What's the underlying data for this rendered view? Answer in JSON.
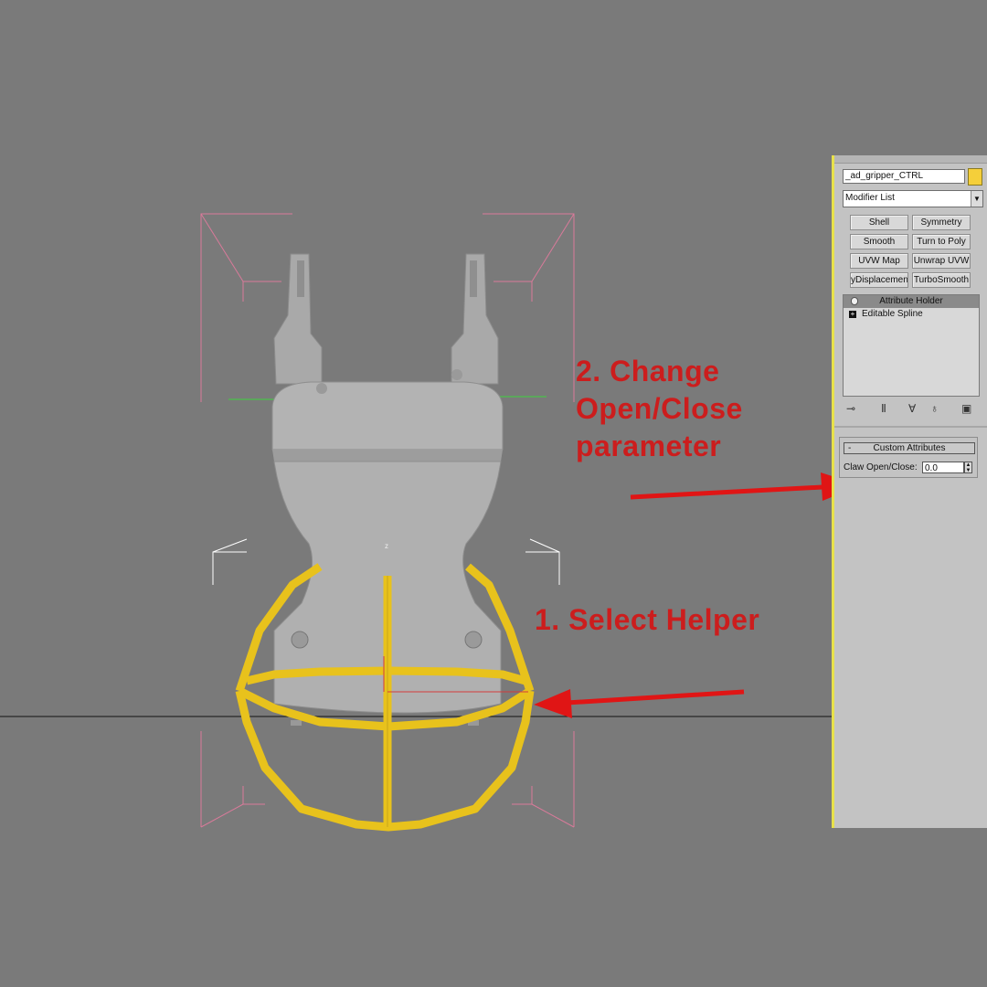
{
  "annotations": {
    "step1": "1. Select Helper",
    "step2": "2. Change Open/Close parameter"
  },
  "viewport": {
    "axis_label": "z",
    "selected_helper_color": "#f5cf3a",
    "bounding_box_color": "#d97a9a"
  },
  "command_panel": {
    "object_name": "_ad_gripper_CTRL",
    "object_color": "#f5cf3a",
    "modifier_list": "Modifier List",
    "modifier_buttons": [
      "Shell",
      "Symmetry",
      "Smooth",
      "Turn to Poly",
      "UVW Map",
      "Unwrap UVW",
      "yDisplacement",
      "TurboSmooth"
    ],
    "stack": [
      {
        "label": "Attribute Holder",
        "selected": true,
        "icon": "light-bulb-icon"
      },
      {
        "label": "Editable Spline",
        "selected": false,
        "icon": "plus-icon"
      }
    ],
    "stack_tools": [
      "pin-stack-icon",
      "show-end-result-icon",
      "make-unique-icon",
      "remove-modifier-icon",
      "configure-sets-icon"
    ],
    "rollout": {
      "title": "Custom Attributes",
      "collapse_symbol": "-",
      "param_label": "Claw Open/Close:",
      "param_value": "0.0"
    }
  },
  "arrow_color": "#e01515"
}
